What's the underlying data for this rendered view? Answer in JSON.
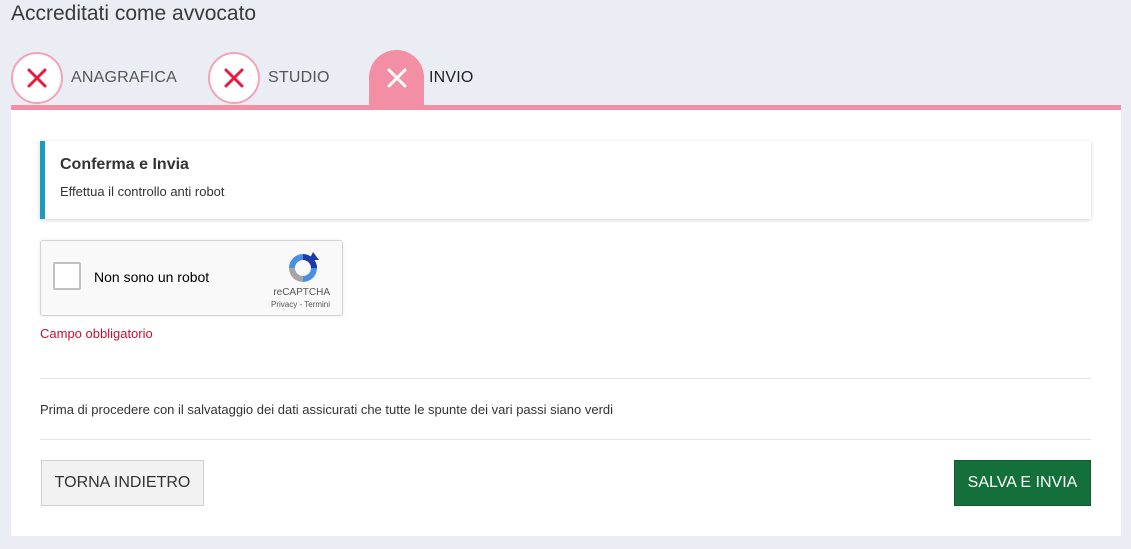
{
  "page": {
    "title": "Accreditati come avvocato"
  },
  "steps": [
    {
      "label": "ANAGRAFICA",
      "status": "error",
      "icon": "close-icon"
    },
    {
      "label": "STUDIO",
      "status": "error",
      "icon": "close-icon"
    },
    {
      "label": "INVIO",
      "status": "active",
      "icon": "close-icon"
    }
  ],
  "callout": {
    "title": "Conferma e Invia",
    "text": "Effettua il controllo anti robot"
  },
  "recaptcha": {
    "label": "Non sono un robot",
    "brand": "reCAPTCHA",
    "links": "Privacy - Termini",
    "checked": false
  },
  "validation": {
    "error": "Campo obbligatorio"
  },
  "note": "Prima di procedere con il salvataggio dei dati assicurati che tutte le spunte dei vari passi siano verdi",
  "actions": {
    "back_label": "TORNA INDIETRO",
    "submit_label": "SALVA E INVIA"
  },
  "colors": {
    "accent_pink": "#f28fa4",
    "error_red": "#e8193c",
    "info_blue": "#1a9cbf",
    "submit_green": "#14703a"
  }
}
